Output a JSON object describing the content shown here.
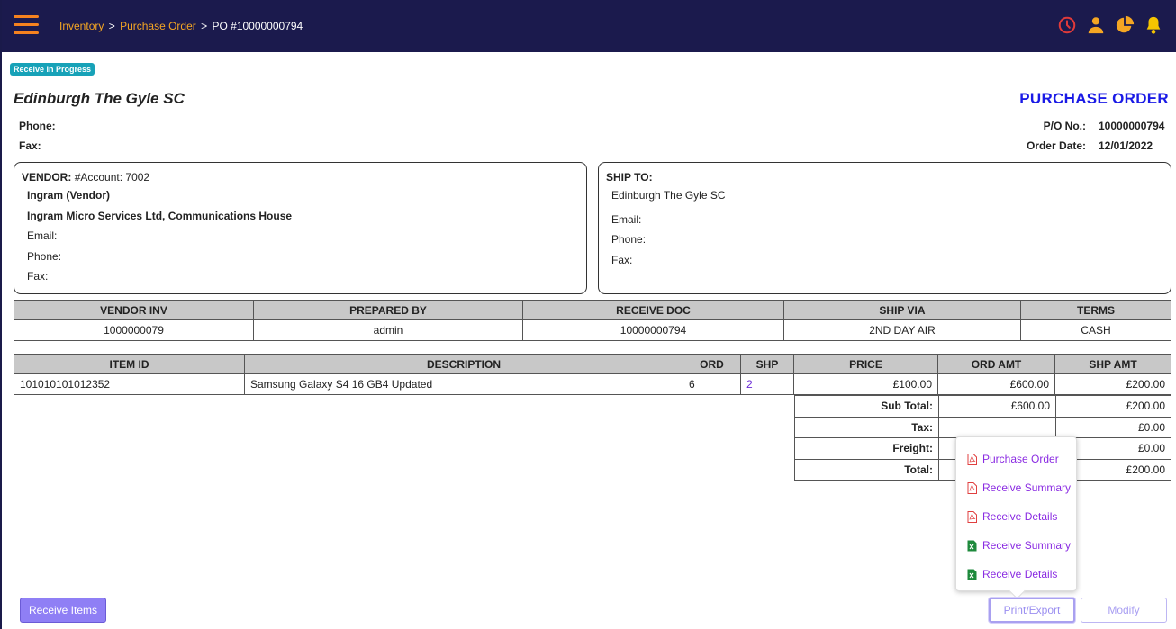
{
  "breadcrumb": {
    "inventory": "Inventory",
    "purchase_order": "Purchase Order",
    "current": "PO #10000000794",
    "sep": ">"
  },
  "status_badge": "Receive In Progress",
  "store_name": "Edinburgh The Gyle SC",
  "doc_title": "PURCHASE ORDER",
  "labels": {
    "phone": "Phone:",
    "fax": "Fax:",
    "po_no": "P/O No.:",
    "order_date": "Order Date:"
  },
  "po": {
    "number": "10000000794",
    "order_date": "12/01/2022"
  },
  "vendor": {
    "heading": "VENDOR:",
    "account": "#Account: 7002",
    "name": "Ingram (Vendor)",
    "company": "Ingram Micro Services Ltd, Communications House",
    "email": "Email:",
    "phone": "Phone:",
    "fax": "Fax:"
  },
  "ship_to": {
    "heading": "SHIP TO:",
    "name": "Edinburgh The Gyle SC",
    "email": "Email:",
    "phone": "Phone:",
    "fax": "Fax:"
  },
  "info_table": {
    "headers": [
      "VENDOR INV",
      "PREPARED BY",
      "RECEIVE DOC",
      "SHIP VIA",
      "TERMS"
    ],
    "row": [
      "1000000079",
      "admin",
      "10000000794",
      "2ND DAY AIR",
      "CASH"
    ]
  },
  "items_table": {
    "headers": [
      "ITEM ID",
      "DESCRIPTION",
      "ORD",
      "SHP",
      "PRICE",
      "ORD AMT",
      "SHP AMT"
    ],
    "rows": [
      {
        "item_id": "101010101012352",
        "description": "Samsung Galaxy S4 16 GB4 Updated",
        "ord": "6",
        "shp": "2",
        "price": "£100.00",
        "ord_amt": "£600.00",
        "shp_amt": "£200.00"
      }
    ]
  },
  "totals": {
    "subtotal_label": "Sub Total:",
    "subtotal_ord": "£600.00",
    "subtotal_shp": "£200.00",
    "tax_label": "Tax:",
    "tax_shp": "£0.00",
    "freight_label": "Freight:",
    "freight_shp": "£0.00",
    "total_label": "Total:",
    "total_shp": "£200.00"
  },
  "export_menu": [
    {
      "label": "Purchase Order",
      "type": "pdf"
    },
    {
      "label": "Receive Summary",
      "type": "pdf"
    },
    {
      "label": "Receive Details",
      "type": "pdf"
    },
    {
      "label": "Receive Summary",
      "type": "excel"
    },
    {
      "label": "Receive Details",
      "type": "excel"
    }
  ],
  "buttons": {
    "receive_items": "Receive Items",
    "print_export": "Print/Export",
    "modify": "Modify"
  },
  "colors": {
    "nav_bg": "#1b1a4d",
    "accent_orange": "#f5821f",
    "clock_red": "#e03a3a",
    "title_blue": "#1a1ae6",
    "badge": "#17a2b8",
    "menu_text": "#8a2be2"
  },
  "icons": [
    "menu-icon",
    "history-clock-icon",
    "user-icon",
    "pie-chart-icon",
    "bell-icon",
    "pdf-file-icon",
    "excel-file-icon"
  ]
}
